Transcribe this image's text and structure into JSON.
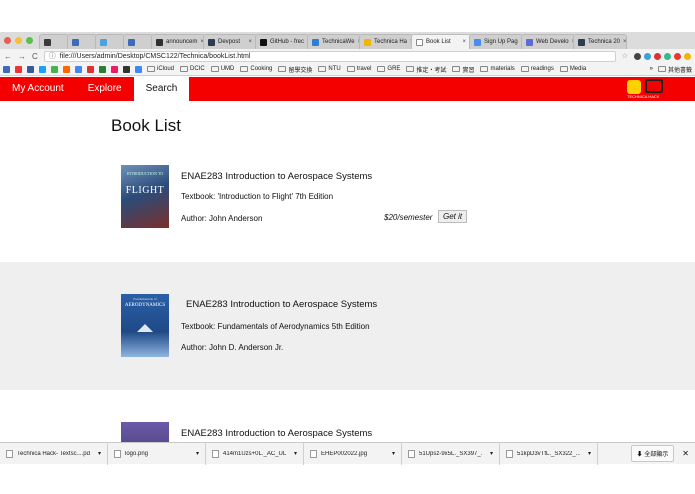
{
  "tabs": [
    {
      "label": "",
      "color": "#3a3a3a"
    },
    {
      "label": "",
      "color": "#3d6bb8"
    },
    {
      "label": "",
      "color": "#4aa3df"
    },
    {
      "label": "",
      "color": "#3d6bb8"
    },
    {
      "label": "announcem",
      "color": "#2f2f2f"
    },
    {
      "label": "Devpost",
      "color": "#2e3b4e"
    },
    {
      "label": "GitHub - frec",
      "color": "#111111"
    },
    {
      "label": "TechnicaWe",
      "color": "#2e7dd7"
    },
    {
      "label": "Technica Ha",
      "color": "#f2b600"
    },
    {
      "label": "Book List",
      "color": "#ffffff",
      "active": true
    },
    {
      "label": "Sign Up Pag",
      "color": "#4a8cf0"
    },
    {
      "label": "Web Develo",
      "color": "#5d6ad1"
    },
    {
      "label": "Technica 20",
      "color": "#2e3b4e"
    }
  ],
  "address": {
    "url": "file:///Users/admin/Desktop/CMSC122/Technica/bookList.html"
  },
  "bookmarks": {
    "items": [
      "iCloud",
      "DCIC",
      "UMD",
      "Cooking",
      "留學交換",
      "NTU",
      "travel",
      "GRE",
      "推定・考試",
      "實習",
      "materials",
      "readings",
      "Media"
    ],
    "more": "»",
    "other": "其他書籤"
  },
  "nav": {
    "account": "My Account",
    "explore": "Explore",
    "search": "Search",
    "logo_text": "TECHNICA HACK"
  },
  "page": {
    "title": "Book List"
  },
  "books": [
    {
      "title": "ENAE283 Introduction to Aerospace Systems",
      "textbook": "Textbook: 'Introduction to Flight' 7th Edition",
      "author": "Author: John Anderson",
      "price": "$20/semester",
      "action": "Get it",
      "cover_title": "FLIGHT",
      "cover_color": "#2b4c7a"
    },
    {
      "title": "ENAE283 Introduction to Aerospace Systems",
      "textbook": "Textbook: Fundamentals of Aerodynamics 5th Edition",
      "author": "Author: John D. Anderson Jr.",
      "cover_title": "AERODYNAMICS",
      "cover_color": "#2a5fa8"
    },
    {
      "title": "ENAE283 Introduction to Aerospace Systems",
      "cover_color": "#4a3f7a"
    }
  ],
  "downloads": {
    "items": [
      "Technica Hack- Textsc....pdf",
      "logo.png",
      "414m1Uzs+0L._AC_UL....jpg",
      "EHEP002022.jpg",
      "51Upsz-9x5L._SX397_....jpg",
      "51kpD3vTfL._SX322_....jpg"
    ],
    "show_all": "全部顯示"
  },
  "colors": {
    "nav_bg": "#f40000",
    "alt_row": "#efefef"
  }
}
